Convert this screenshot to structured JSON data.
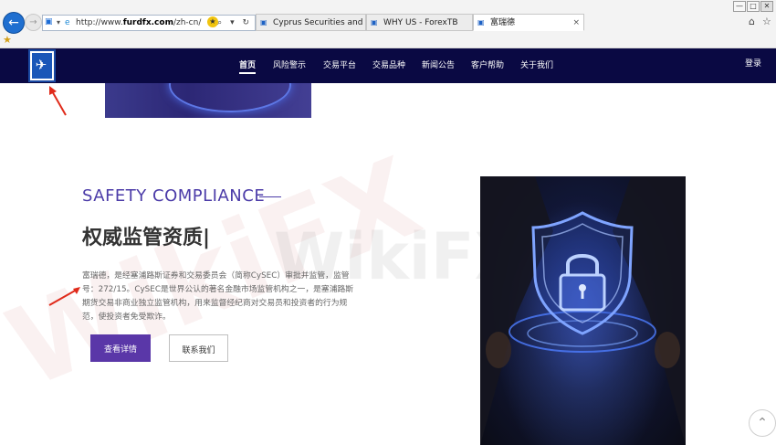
{
  "browser": {
    "url_prefix": "http://www.",
    "url_domain": "furdfx.com",
    "url_path": "/zh-cn/",
    "address_controls": "⌕ ▾ ↻",
    "tabs": [
      {
        "label": "Cyprus Securities and Excha...",
        "icon": "ie-page-icon",
        "close": ""
      },
      {
        "label": "WHY US - ForexTB",
        "icon": "ie-page-icon",
        "close": ""
      },
      {
        "label": "富瑞德",
        "icon": "ie-page-icon",
        "close": "×"
      }
    ],
    "window_controls": [
      "—",
      "□",
      "✕"
    ]
  },
  "site": {
    "nav": {
      "items": [
        {
          "label": "首页",
          "active": true
        },
        {
          "label": "风险警示",
          "active": false
        },
        {
          "label": "交易平台",
          "active": false
        },
        {
          "label": "交易品种",
          "active": false
        },
        {
          "label": "新闻公告",
          "active": false
        },
        {
          "label": "客户帮助",
          "active": false
        },
        {
          "label": "关于我们",
          "active": false
        }
      ],
      "login": "登录"
    },
    "section": {
      "title_en": "SAFETY COMPLIANCE",
      "title_cn": "权威监管资质|",
      "description": "富瑞德，是经塞浦路斯证券和交易委员会（简称CySEC）审批并监管，监管号：272/15。CySEC是世界公认的著名金融市场监管机构之一，是塞浦路斯期货交易非商业独立监管机构，用来监督经纪商对交易员和投资者的行为规范，使投资者免受欺诈。",
      "primary_button": "查看详情",
      "secondary_button": "联系我们"
    },
    "watermark": "WikiFX"
  },
  "colors": {
    "nav_bg": "#0a0943",
    "accent_purple": "#5a37a8",
    "title_purple": "#4b3ba8",
    "annotation_red": "#e02a1a"
  }
}
